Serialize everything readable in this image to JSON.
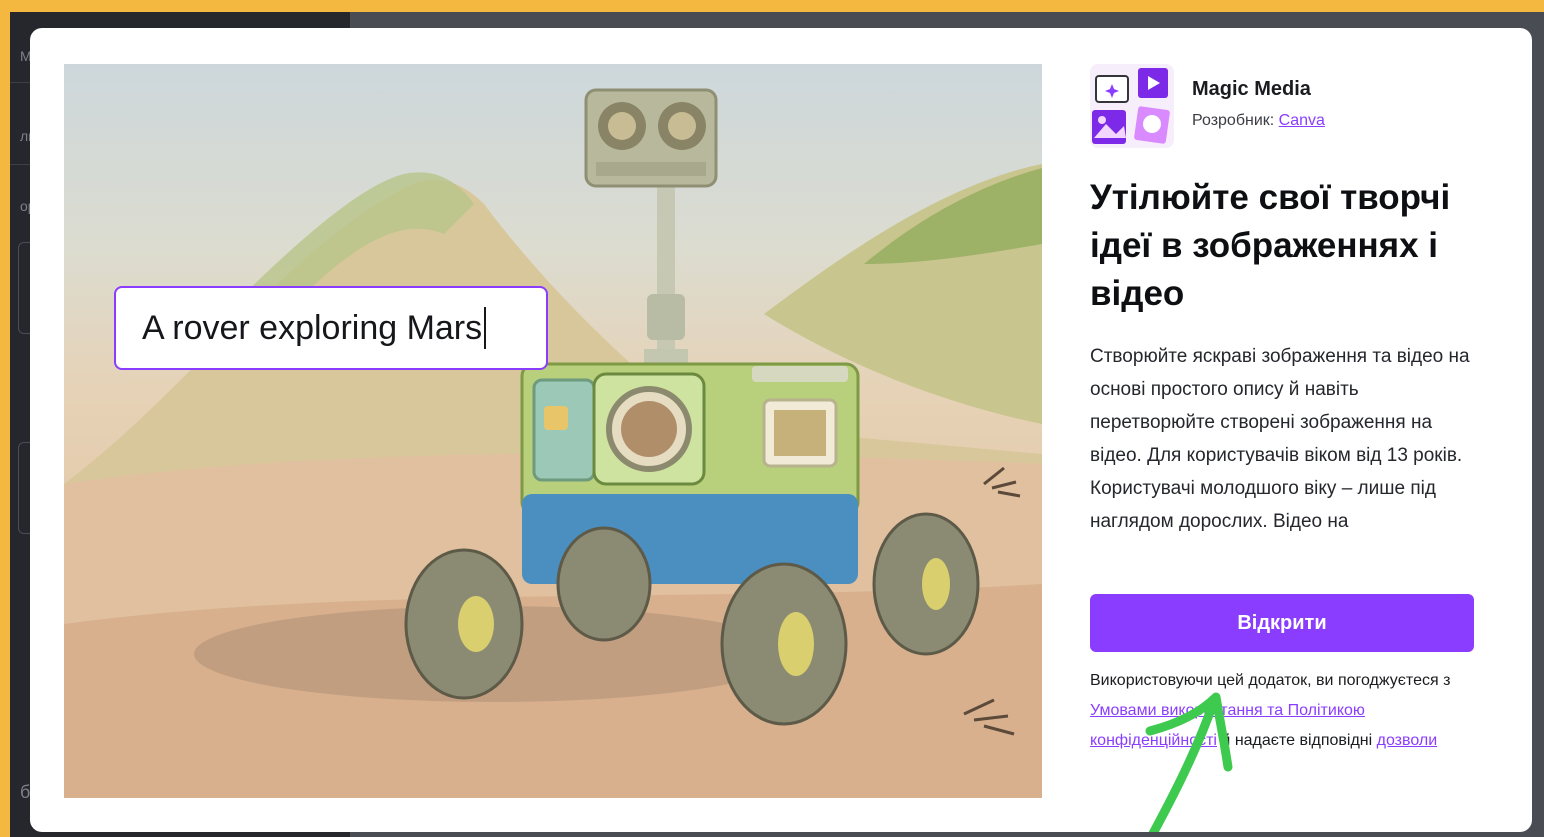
{
  "left_panel": {
    "ghost_labels": [
      "Mo",
      "лк",
      "ор",
      "б"
    ]
  },
  "hero": {
    "prompt_text": "A rover exploring Mars"
  },
  "app": {
    "name": "Magic Media",
    "developer_prefix": "Розробник: ",
    "developer_name": "Canva",
    "icon": "magic-media-app-icon"
  },
  "headline": "Утілюйте свої творчі ідеї в зображеннях і відео",
  "description": "Створюйте яскраві зображення та відео на основі простого опису й навіть перетворюйте створені зображення на відео. Для користувачів віком від 13 років. Користувачі молодшого віку – лише під наглядом дорослих. Відео на",
  "open_button": "Відкрити",
  "terms": {
    "prefix": "Використовуючи цей додаток, ви погоджуєтеся з ",
    "link1": "Умовами використання та Політикою конфіденційності",
    "middle": " й надаєте відповідні ",
    "link2": "дозволи"
  },
  "colors": {
    "frame": "#f4b740",
    "accent": "#8b3dff",
    "annotation_arrow": "#3ec94f"
  }
}
